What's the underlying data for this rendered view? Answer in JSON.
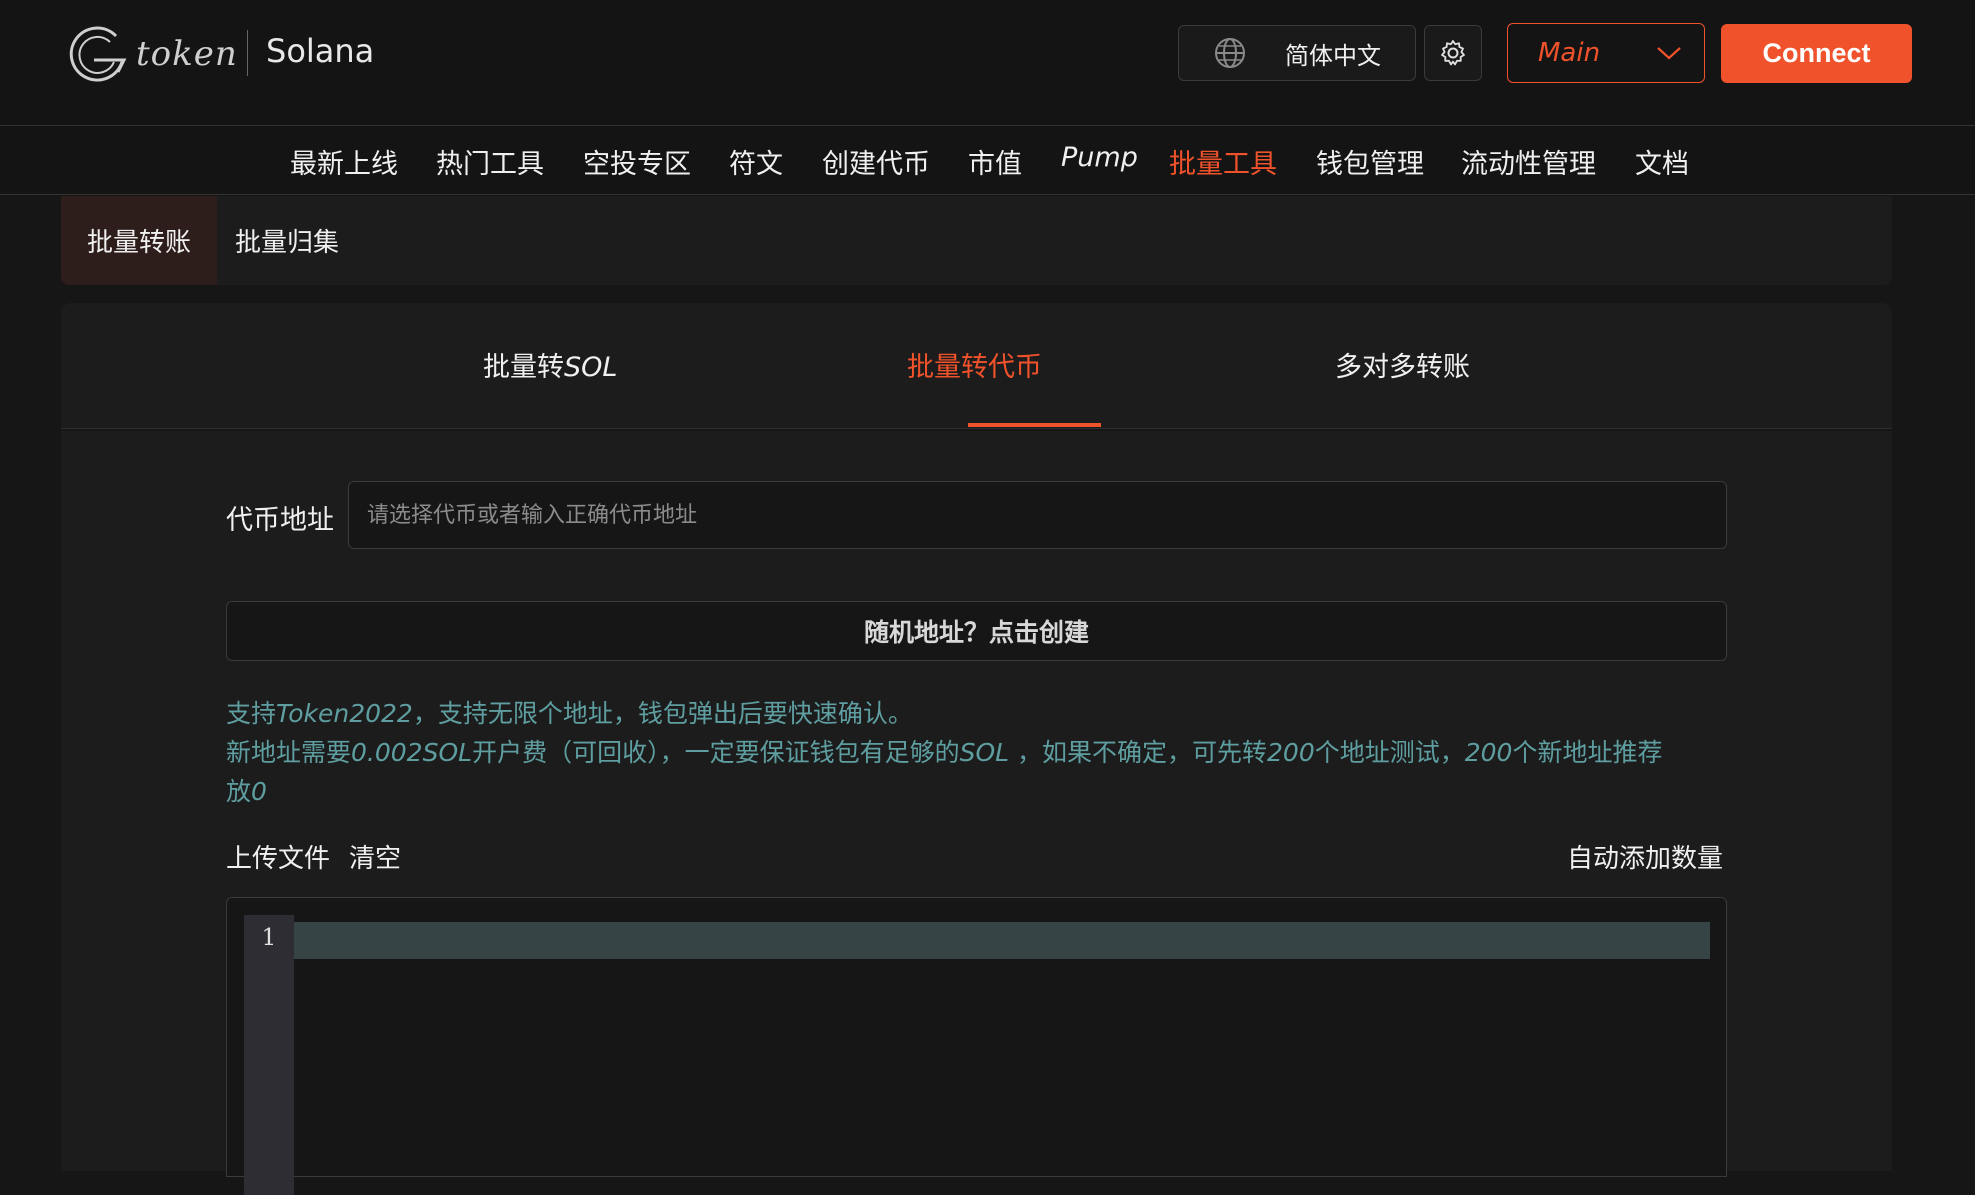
{
  "header": {
    "logo_word": "token",
    "chain_name": "Solana",
    "language": "简体中文",
    "network": "Main",
    "connect_label": "Connect"
  },
  "nav": {
    "items": [
      "最新上线",
      "热门工具",
      "空投专区",
      "符文",
      "创建代币",
      "市值",
      "Pump",
      "批量工具",
      "钱包管理",
      "流动性管理",
      "文档"
    ],
    "active": "批量工具"
  },
  "subtabs": [
    "批量转账",
    "批量归集"
  ],
  "card_tabs": {
    "tab1_prefix": "批量转",
    "tab1_suffix": "SOL",
    "tab2": "批量转代币",
    "tab3": "多对多转账",
    "active": "批量转代币"
  },
  "form": {
    "token_address_label": "代币地址",
    "token_address_placeholder": "请选择代币或者输入正确代币地址",
    "token_address_value": "",
    "random_address_button": "随机地址？点击创建",
    "notice": {
      "l1_a": "支持",
      "l1_b": "Token2022",
      "l1_c": "，支持无限个地址，钱包弹出后要快速确认。",
      "l2_a": "新地址需要",
      "l2_b": "0.002SOL",
      "l2_c": "开户费（可回收），一定要保证钱包有足够的",
      "l2_d": "SOL",
      "l2_e": " ，如果不确定，可先转",
      "l2_f": "200",
      "l2_g": "个地址测试，",
      "l2_h": "200",
      "l2_i": "个新地址推荐",
      "l3_a": "放",
      "l3_b": "0"
    },
    "upload_file": "上传文件",
    "clear": "清空",
    "auto_add_amount": "自动添加数量"
  },
  "editor": {
    "line_numbers": [
      "1"
    ]
  },
  "colors": {
    "accent": "#f0522b",
    "notice": "#5f9ea0",
    "background": "#161616",
    "card": "#1c1c1c"
  },
  "icons": [
    "logo-g-icon",
    "globe-icon",
    "gear-icon",
    "chevron-down-icon"
  ]
}
